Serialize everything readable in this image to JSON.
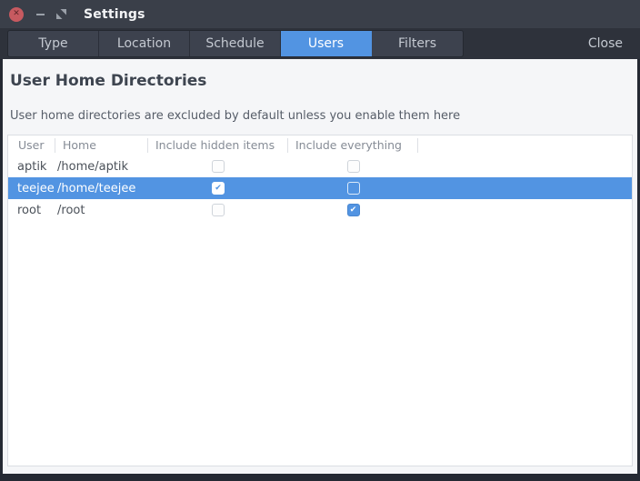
{
  "window": {
    "title": "Settings"
  },
  "icons": {
    "close_x": "✕",
    "check": "✔"
  },
  "tabbar": {
    "tabs": [
      {
        "label": "Type",
        "active": false
      },
      {
        "label": "Location",
        "active": false
      },
      {
        "label": "Schedule",
        "active": false
      },
      {
        "label": "Users",
        "active": true
      },
      {
        "label": "Filters",
        "active": false
      }
    ],
    "close_label": "Close"
  },
  "main": {
    "heading": "User Home Directories",
    "subtitle": "User home directories are excluded by default unless you enable them here"
  },
  "table": {
    "columns": [
      "User",
      "Home",
      "Include hidden items",
      "Include everything"
    ],
    "rows": [
      {
        "user": "aptik",
        "home": "/home/aptik",
        "include_hidden": false,
        "include_everything": false,
        "selected": false
      },
      {
        "user": "teejee",
        "home": "/home/teejee",
        "include_hidden": true,
        "include_everything": false,
        "selected": true
      },
      {
        "user": "root",
        "home": "/root",
        "include_hidden": false,
        "include_everything": true,
        "selected": false
      }
    ]
  },
  "colors": {
    "accent_blue": "#5294e2",
    "titlebar": "#3a3f49",
    "tabbar": "#2e323b",
    "close_button_red": "#c75a60",
    "content_bg": "#f5f6f8",
    "table_border": "#dbdee3"
  }
}
